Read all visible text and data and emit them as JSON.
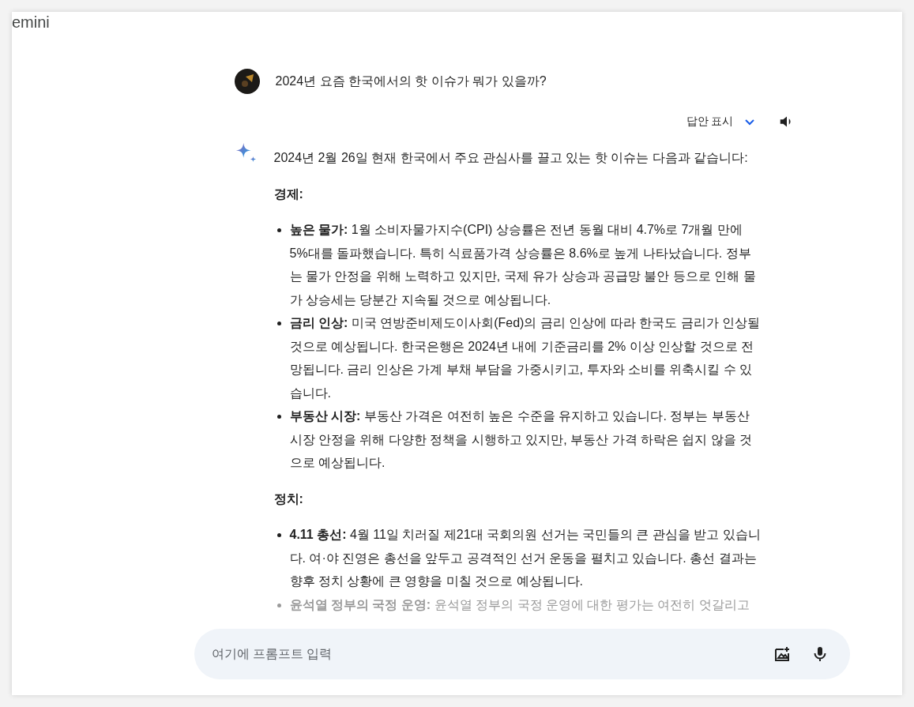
{
  "app_title": "emini",
  "user_message": {
    "text": "2024년 요즘 한국에서의 핫 이슈가 뭐가 있을까?"
  },
  "response_toolbar": {
    "drafts_label": "답안 표시",
    "drafts_expanded": false
  },
  "response": {
    "intro": "2024년 2월 26일 현재 한국에서 주요 관심사를 끌고 있는 핫 이슈는 다음과 같습니다:",
    "sections": [
      {
        "heading": "경제:",
        "items": [
          {
            "text": "**높은 물가:** 1월 소비자물가지수(CPI) 상승률은 전년 동월 대비 4.7%로 7개월 만에 5%대를 돌파했습니다. 특히 식료품가격 상승률은 8.6%로 높게 나타났습니다. 정부는 물가 안정을 위해 노력하고 있지만, 국제 유가 상승과 공급망 불안 등으로 인해 물가 상승세는 당분간 지속될 것으로 예상됩니다.",
            "faded": false
          },
          {
            "text": "**금리 인상:** 미국 연방준비제도이사회(Fed)의 금리 인상에 따라 한국도 금리가 인상될 것으로 예상됩니다. 한국은행은 2024년 내에 기준금리를 2% 이상 인상할 것으로 전망됩니다. 금리 인상은 가계 부채 부담을 가중시키고, 투자와 소비를 위축시킬 수 있습니다.",
            "faded": false
          },
          {
            "text": "**부동산 시장:** 부동산 가격은 여전히 높은 수준을 유지하고 있습니다. 정부는 부동산 시장 안정을 위해 다양한 정책을 시행하고 있지만, 부동산 가격 하락은 쉽지 않을 것으로 예상됩니다.",
            "faded": false
          }
        ]
      },
      {
        "heading": "정치:",
        "items": [
          {
            "text": "**4.11 총선:** 4월 11일 치러질 제21대 국회의원 선거는 국민들의 큰 관심을 받고 있습니다. 여·야 진영은 총선을 앞두고 공격적인 선거 운동을 펼치고 있습니다. 총선 결과는 향후 정치 상황에 큰 영향을 미칠 것으로 예상됩니다.",
            "faded": false
          },
          {
            "text": "**윤석열 정부의 국정 운영:** 윤석열 정부의 국정 운영에 대한 평가는 여전히 엇갈리고",
            "faded": true
          }
        ]
      }
    ]
  },
  "prompt_input": {
    "placeholder": "여기에 프롬프트 입력"
  }
}
